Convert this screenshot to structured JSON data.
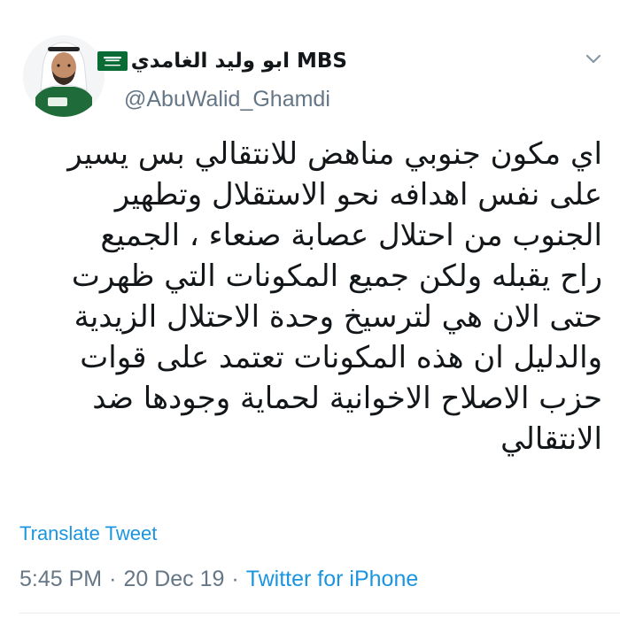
{
  "author": {
    "display_name": "ابو وليد الغامدي MBS",
    "handle": "@AbuWalid_Ghamdi",
    "flag_icon": "saudi-flag-icon"
  },
  "tweet": {
    "text": "اي مكون جنوبي مناهض للانتقالي بس يسير\nعلى نفس اهدافه نحو الاستقلال وتطهير\nالجنوب من احتلال عصابة صنعاء ، الجميع\nراح يقبله ولكن جميع المكونات التي ظهرت\nحتى الان هي لترسيخ وحدة الاحتلال الزيدية\nوالدليل ان هذه المكونات تعتمد على قوات\nحزب الاصلاح الاخوانية لحماية وجودها ضد\nالانتقالي",
    "translate_label": "Translate Tweet",
    "time": "5:45 PM",
    "separator": "·",
    "date": "20 Dec 19",
    "source": "Twitter for iPhone"
  },
  "colors": {
    "link": "#1b95e0",
    "secondary": "#657786",
    "text": "#14171a",
    "divider": "#e6ecf0"
  }
}
